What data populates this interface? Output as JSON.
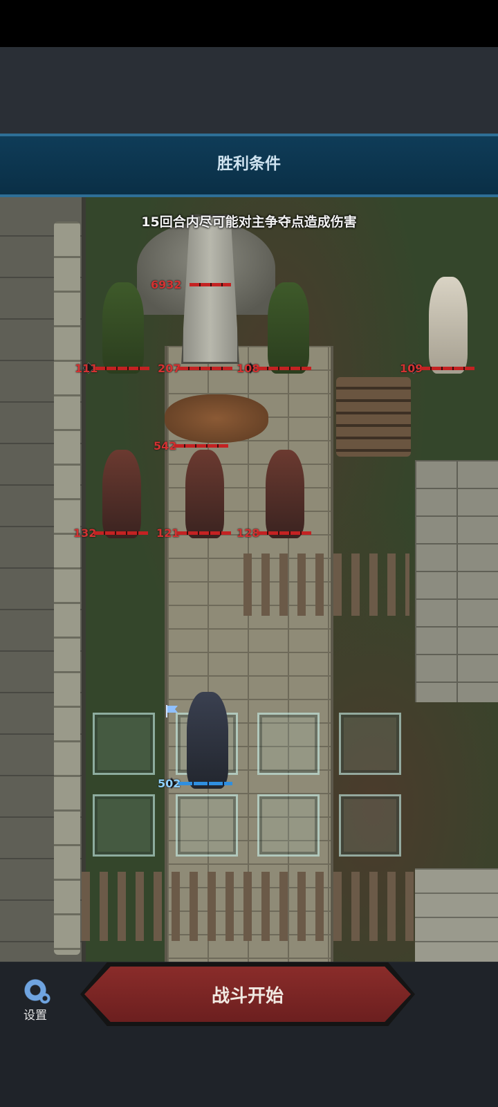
{
  "banner": {
    "title": "胜利条件"
  },
  "condition": {
    "text": "15回合内尽可能对主争夺点造成伤害"
  },
  "enemies": {
    "obelisk_hp": "6932",
    "archer_left_hp": "111",
    "center_hp": "207",
    "archer_right_hp": "108",
    "shaman_hp": "109",
    "bear_hp": "542",
    "axeman1_hp": "132",
    "axeman2_hp": "121",
    "axeman3_hp": "128"
  },
  "player": {
    "hero_hp": "502"
  },
  "bottom": {
    "settings_label": "设置",
    "start_label": "战斗开始"
  }
}
